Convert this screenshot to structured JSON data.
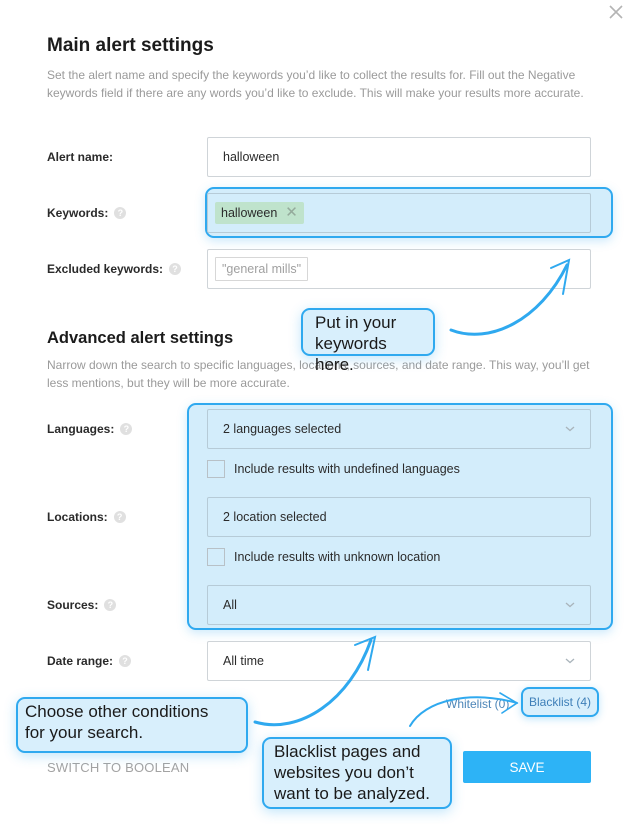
{
  "close_icon": "close-icon",
  "main": {
    "title": "Main alert settings",
    "description": "Set the alert name and specify the keywords you’d like to collect the results for. Fill out the Negative keywords field if there are any words you’d like to exclude. This will make your results more accurate.",
    "alert_name": {
      "label": "Alert name:",
      "value": "halloween"
    },
    "keywords": {
      "label": "Keywords:",
      "help": "?",
      "tags": [
        "halloween"
      ],
      "tag_remove": "✕"
    },
    "excluded": {
      "label": "Excluded keywords:",
      "help": "?",
      "placeholder_chip": "\"general mills\""
    }
  },
  "advanced": {
    "title": "Advanced alert settings",
    "description": "Narrow down the search to specific languages, locations, sources, and date range. This way, you’ll get less mentions, but they will be more accurate.",
    "languages": {
      "label": "Languages:",
      "help": "?",
      "value": "2 languages selected",
      "checkbox_label": "Include results with undefined languages",
      "checked": false
    },
    "locations": {
      "label": "Locations:",
      "help": "?",
      "value": "2 location selected",
      "checkbox_label": "Include results with unknown location",
      "checked": false
    },
    "sources": {
      "label": "Sources:",
      "help": "?",
      "value": "All"
    },
    "date_range": {
      "label": "Date range:",
      "help": "?",
      "value": "All time"
    }
  },
  "links": {
    "whitelist": "Whitelist (0)",
    "blacklist": "Blacklist (4)"
  },
  "actions": {
    "boolean": "SWITCH TO BOOLEAN",
    "save": "SAVE"
  },
  "callouts": {
    "keywords_l1": "Put in your",
    "keywords_l2": "keywords here.",
    "conditions_l1": "Choose other conditions",
    "conditions_l2": "for your search.",
    "blacklist_l1": "Blacklist pages and",
    "blacklist_l2": "websites you don’t",
    "blacklist_l3": "want to be analyzed."
  },
  "colors": {
    "accent": "#2fa9ef",
    "highlight_bg": "#d3edfb",
    "tag_bg": "#bfe3cc",
    "save_bg": "#2db3f6",
    "link": "#3e7fb8"
  }
}
